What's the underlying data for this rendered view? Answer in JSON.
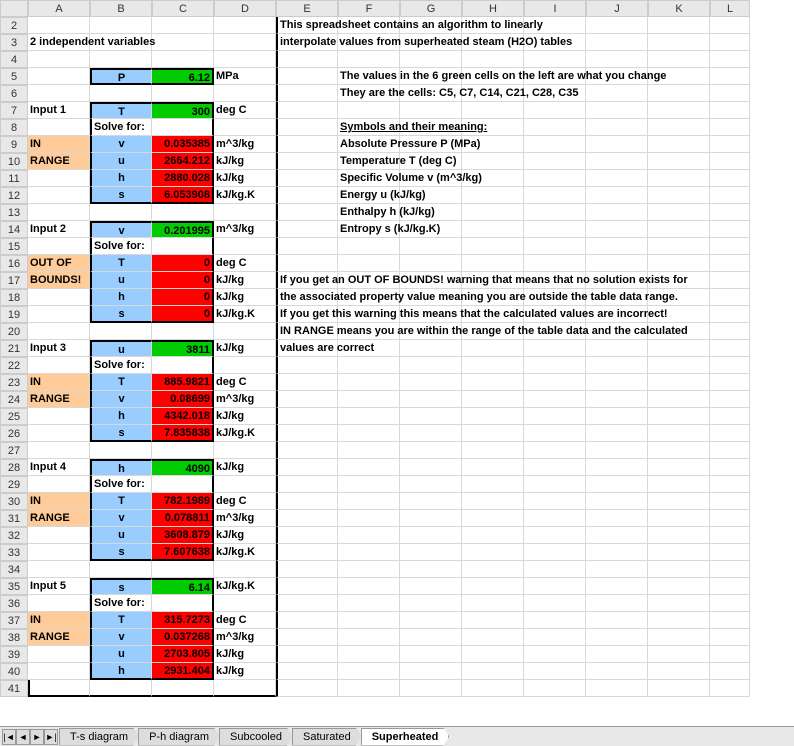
{
  "columns": [
    "A",
    "B",
    "C",
    "D",
    "E",
    "F",
    "G",
    "H",
    "I",
    "J",
    "K",
    "L"
  ],
  "title": {
    "line1": "This spreadsheet contains an algorithm to linearly",
    "line2": "interpolate values from superheated steam (H2O) tables",
    "subtitle": "2 independent variables"
  },
  "instructions": {
    "green1": "The values in the 6 green cells on the left are what you change",
    "green2": "They are the cells: C5, C7, C14, C21, C28, C35",
    "symbols_header": "Symbols and their meaning:",
    "symbols": [
      "Absolute Pressure P (MPa)",
      "Temperature T (deg C)",
      "Specific Volume v (m^3/kg)",
      "Energy u (kJ/kg)",
      "Enthalpy h (kJ/kg)",
      "Entropy s (kJ/kg.K)"
    ],
    "oob1": "If you get an OUT OF BOUNDS! warning that means that no solution exists for",
    "oob2": "the associated property value meaning you are outside the table data range.",
    "oob3": "If you get this warning this means that the calculated values are incorrect!",
    "oob4": "IN RANGE means you are within the range of the table data and the calculated",
    "oob5": "values are correct"
  },
  "pressure": {
    "label": "P",
    "value": "6.12",
    "unit": "MPa"
  },
  "input1": {
    "title": "Input 1",
    "solve": "Solve for:",
    "status1": "IN",
    "status2": "RANGE",
    "param": {
      "label": "T",
      "value": "300",
      "unit": "deg C"
    },
    "rows": [
      {
        "label": "v",
        "value": "0.035385",
        "unit": "m^3/kg"
      },
      {
        "label": "u",
        "value": "2664.212",
        "unit": "kJ/kg"
      },
      {
        "label": "h",
        "value": "2880.028",
        "unit": "kJ/kg"
      },
      {
        "label": "s",
        "value": "6.053908",
        "unit": "kJ/kg.K"
      }
    ]
  },
  "input2": {
    "title": "Input 2",
    "solve": "Solve for:",
    "status1": "OUT OF",
    "status2": "BOUNDS!",
    "param": {
      "label": "v",
      "value": "0.201995",
      "unit": "m^3/kg"
    },
    "rows": [
      {
        "label": "T",
        "value": "0",
        "unit": "deg C"
      },
      {
        "label": "u",
        "value": "0",
        "unit": "kJ/kg"
      },
      {
        "label": "h",
        "value": "0",
        "unit": "kJ/kg"
      },
      {
        "label": "s",
        "value": "0",
        "unit": "kJ/kg.K"
      }
    ]
  },
  "input3": {
    "title": "Input 3",
    "solve": "Solve for:",
    "status1": "IN",
    "status2": "RANGE",
    "param": {
      "label": "u",
      "value": "3811",
      "unit": "kJ/kg"
    },
    "rows": [
      {
        "label": "T",
        "value": "885.9821",
        "unit": "deg C"
      },
      {
        "label": "v",
        "value": "0.08699",
        "unit": "m^3/kg"
      },
      {
        "label": "h",
        "value": "4342.018",
        "unit": "kJ/kg"
      },
      {
        "label": "s",
        "value": "7.835838",
        "unit": "kJ/kg.K"
      }
    ]
  },
  "input4": {
    "title": "Input 4",
    "solve": "Solve for:",
    "status1": "IN",
    "status2": "RANGE",
    "param": {
      "label": "h",
      "value": "4090",
      "unit": "kJ/kg"
    },
    "rows": [
      {
        "label": "T",
        "value": "782.1989",
        "unit": "deg C"
      },
      {
        "label": "v",
        "value": "0.078811",
        "unit": "m^3/kg"
      },
      {
        "label": "u",
        "value": "3608.879",
        "unit": "kJ/kg"
      },
      {
        "label": "s",
        "value": "7.607638",
        "unit": "kJ/kg.K"
      }
    ]
  },
  "input5": {
    "title": "Input 5",
    "solve": "Solve for:",
    "status1": "IN",
    "status2": "RANGE",
    "param": {
      "label": "s",
      "value": "6.14",
      "unit": "kJ/kg.K"
    },
    "rows": [
      {
        "label": "T",
        "value": "315.7273",
        "unit": "deg C"
      },
      {
        "label": "v",
        "value": "0.037268",
        "unit": "m^3/kg"
      },
      {
        "label": "u",
        "value": "2703.805",
        "unit": "kJ/kg"
      },
      {
        "label": "h",
        "value": "2931.404",
        "unit": "kJ/kg"
      }
    ]
  },
  "tabs": [
    "T-s diagram",
    "P-h diagram",
    "Subcooled",
    "Saturated",
    "Superheated"
  ],
  "active_tab": "Superheated",
  "nav": {
    "first": "|◄",
    "prev": "◄",
    "next": "►",
    "last": "►|"
  }
}
